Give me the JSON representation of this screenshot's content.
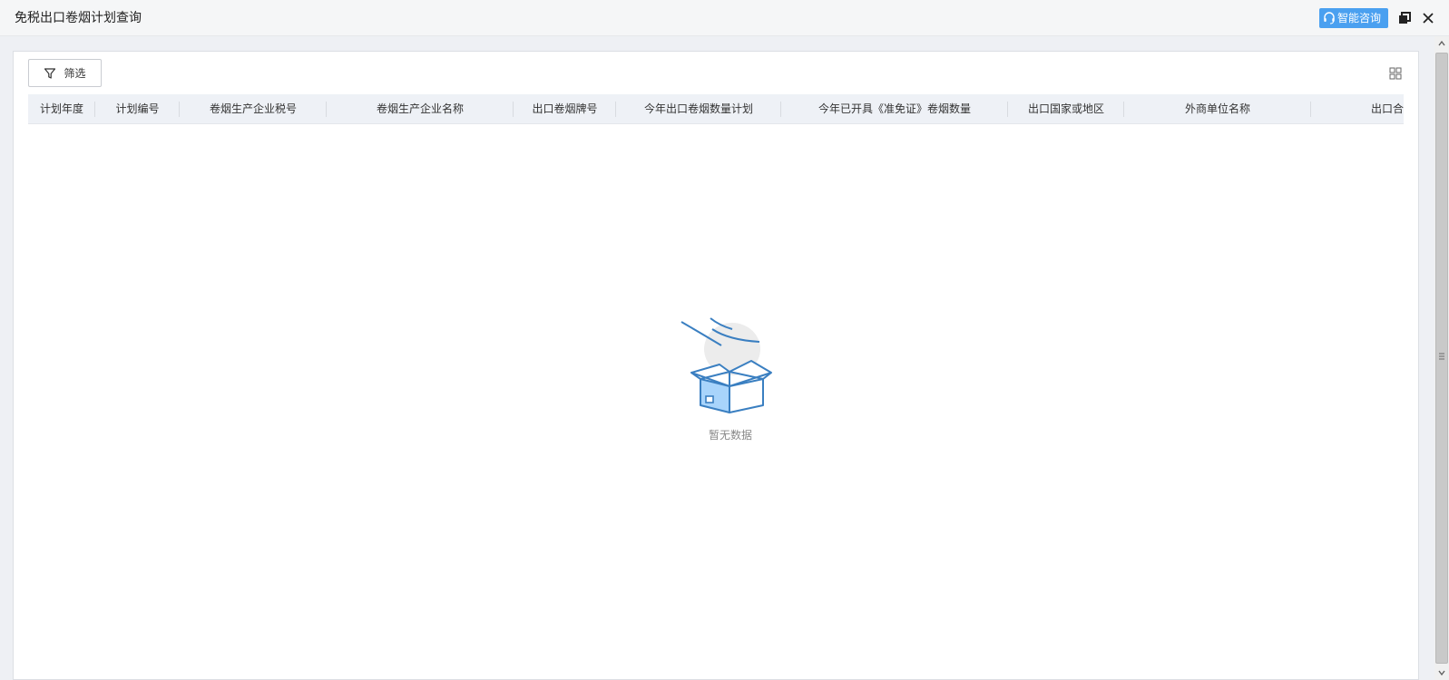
{
  "window": {
    "title": "免税出口卷烟计划查询",
    "consult_label": "智能咨询"
  },
  "toolbar": {
    "filter_label": "筛选"
  },
  "table": {
    "columns": [
      "计划年度",
      "计划编号",
      "卷烟生产企业税号",
      "卷烟生产企业名称",
      "出口卷烟牌号",
      "今年出口卷烟数量计划",
      "今年已开具《准免证》卷烟数量",
      "出口国家或地区",
      "外商单位名称",
      "出口合"
    ],
    "empty_text": "暂无数据"
  },
  "colors": {
    "accent": "#4aa0f0",
    "header_bg": "#eef1f6",
    "empty_box": "#3a7fc1"
  },
  "icons": {
    "consult": "headset-icon",
    "restore": "restore-window-icon",
    "close": "close-icon",
    "filter": "funnel-icon",
    "columns": "grid-icon",
    "empty": "empty-box-illustration"
  }
}
